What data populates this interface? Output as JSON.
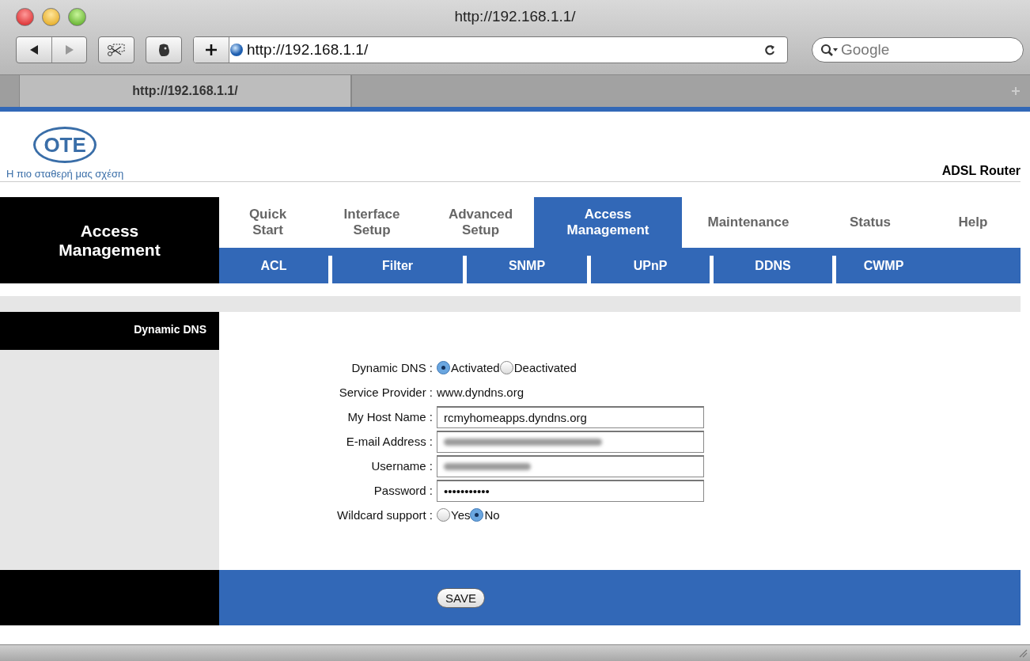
{
  "browser": {
    "window_title": "http://192.168.1.1/",
    "address": "http://192.168.1.1/",
    "search_placeholder": "Google",
    "tabs": [
      {
        "label": "http://192.168.1.1/",
        "selected": true
      },
      {
        "selected": false
      }
    ]
  },
  "header": {
    "logo_text": "OTE",
    "slogan": "Η πιο σταθερή μας σχέση",
    "product": "ADSL Router"
  },
  "section_title": "Access Management",
  "nav": [
    {
      "label": "Quick Start",
      "selected": false
    },
    {
      "label": "Interface Setup",
      "selected": false
    },
    {
      "label": "Advanced Setup",
      "selected": false
    },
    {
      "label": "Access Management",
      "selected": true
    },
    {
      "label": "Maintenance",
      "selected": false
    },
    {
      "label": "Status",
      "selected": false
    },
    {
      "label": "Help",
      "selected": false
    }
  ],
  "subnav": [
    "ACL",
    "Filter",
    "SNMP",
    "UPnP",
    "DDNS",
    "CWMP"
  ],
  "sidebar": {
    "title": "Dynamic DNS"
  },
  "form": [
    {
      "kind": "radio",
      "label": "Dynamic DNS :",
      "options": [
        {
          "label": "Activated",
          "selected": true
        },
        {
          "label": "Deactivated",
          "selected": false
        }
      ]
    },
    {
      "kind": "text",
      "label": "Service Provider :",
      "value": "www.dyndns.org"
    },
    {
      "kind": "input",
      "label": "My Host Name :",
      "value": "rcmyhomeapps.dyndns.org",
      "redacted": false
    },
    {
      "kind": "input",
      "label": "E-mail Address :",
      "redacted": true
    },
    {
      "kind": "input",
      "label": "Username :",
      "redacted": true
    },
    {
      "kind": "input",
      "label": "Password :",
      "value": "•••••••••••",
      "redacted": false
    },
    {
      "kind": "radio",
      "label": "Wildcard support :",
      "options": [
        {
          "label": "Yes",
          "selected": false
        },
        {
          "label": "No",
          "selected": true
        }
      ]
    }
  ],
  "save_button": "SAVE"
}
